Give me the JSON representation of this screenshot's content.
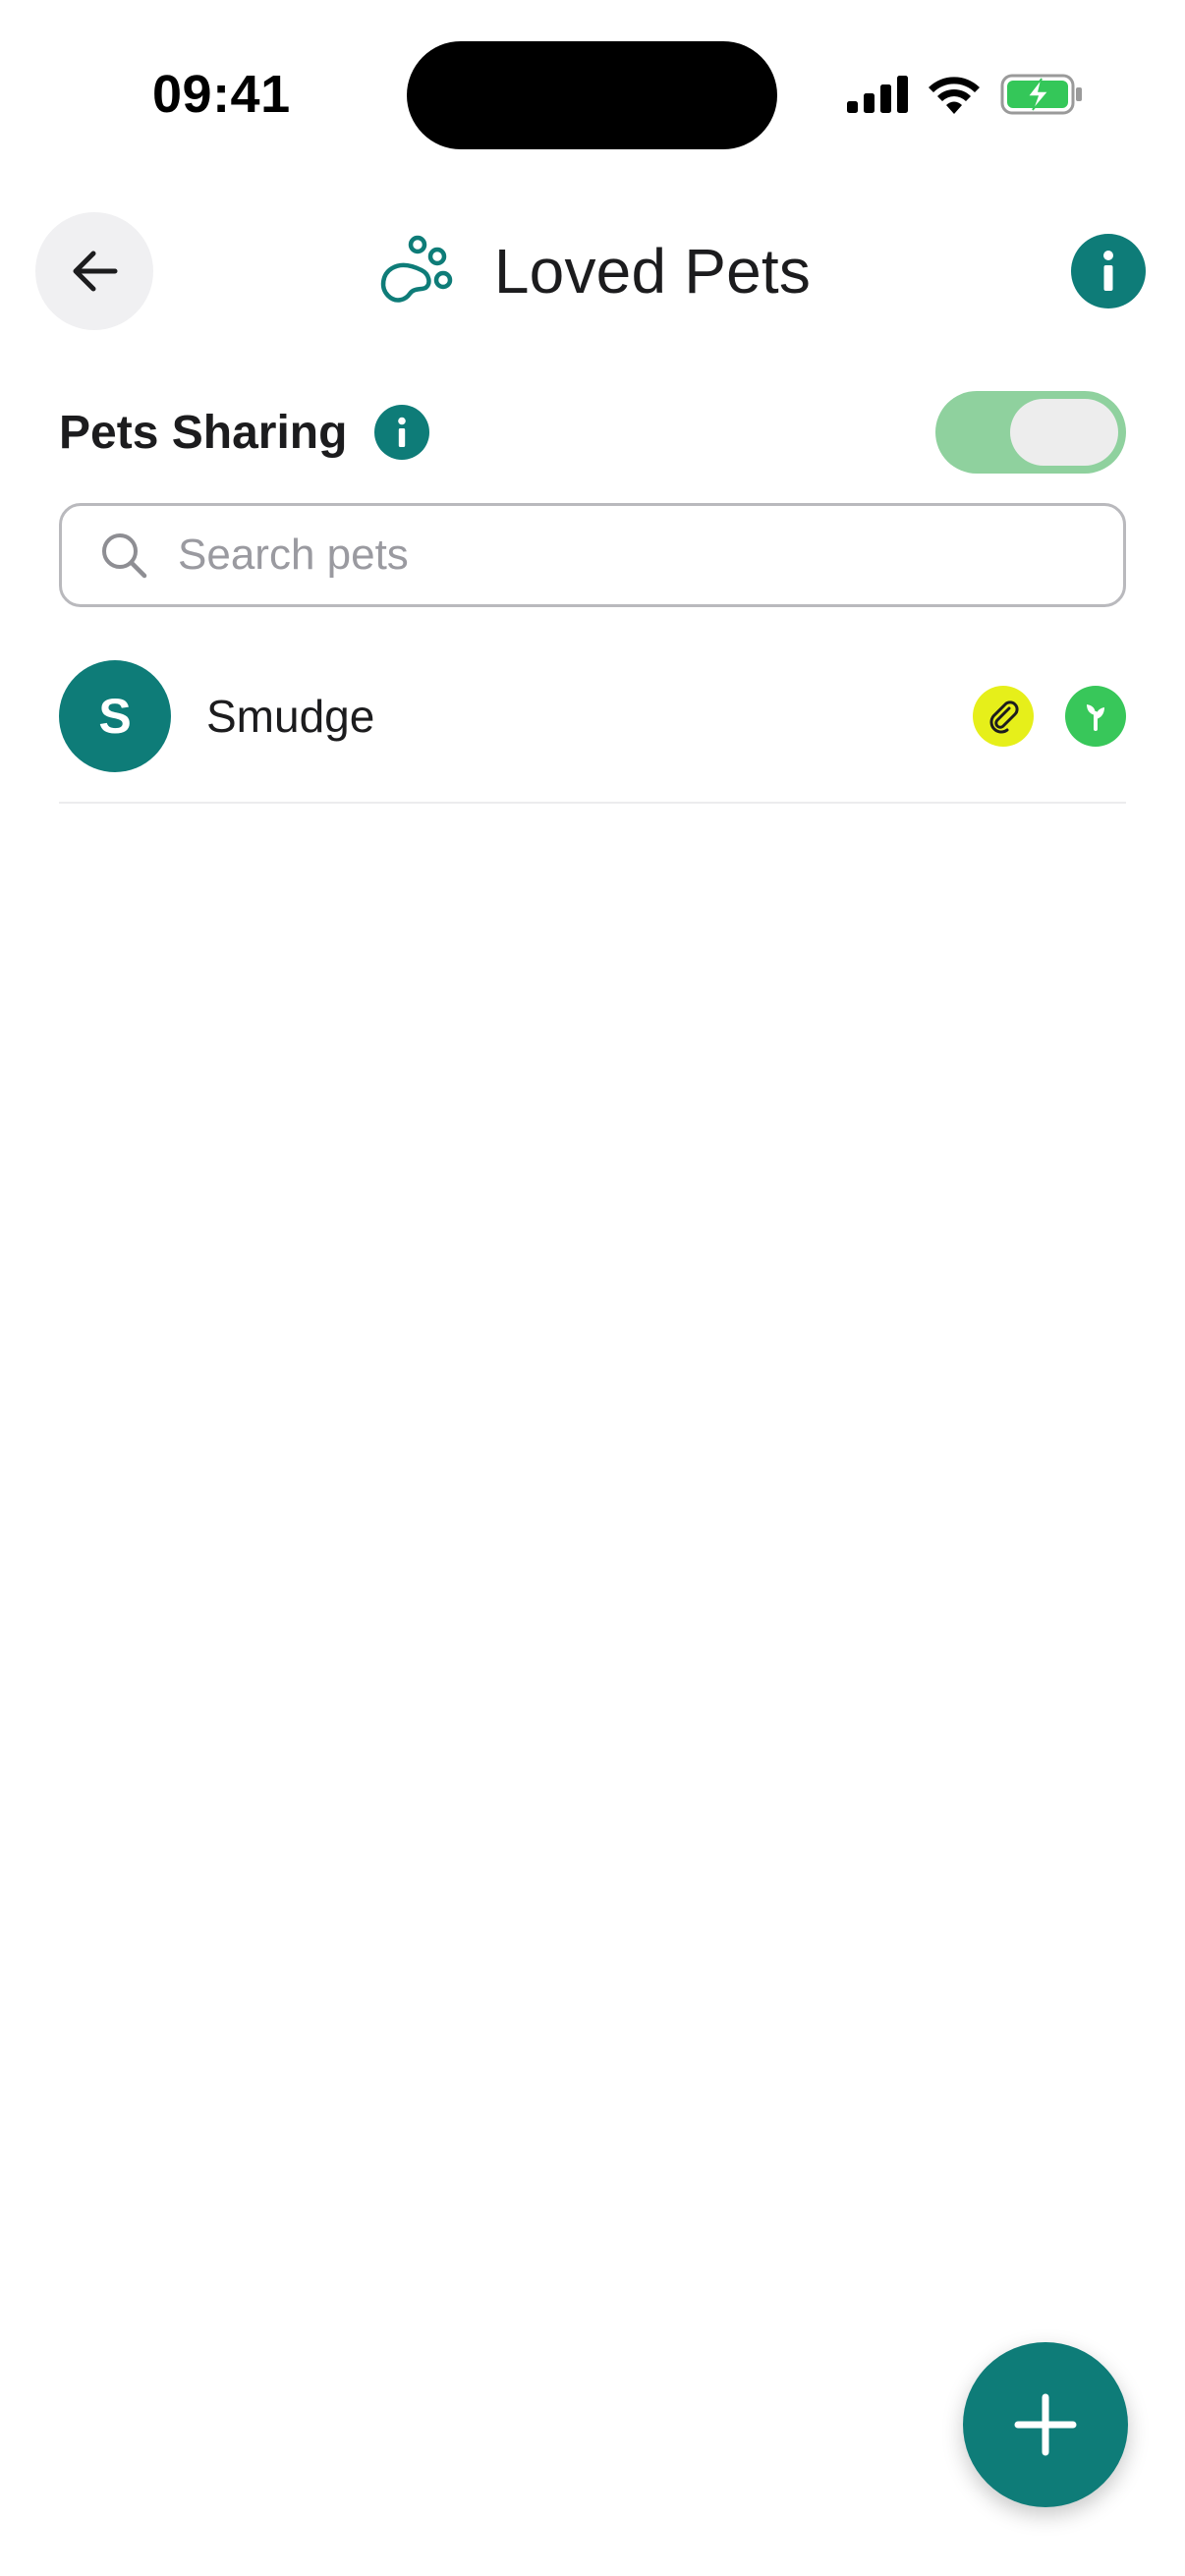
{
  "status_bar": {
    "time": "09:41",
    "icons": [
      "cellular-signal-icon",
      "wifi-icon",
      "battery-charging-icon"
    ]
  },
  "header": {
    "title": "Loved Pets",
    "back_icon": "arrow-left-icon",
    "title_icon": "paw-icon",
    "info_icon": "info-icon"
  },
  "sharing": {
    "label": "Pets Sharing",
    "info_icon": "info-icon",
    "toggle_on": true
  },
  "search": {
    "placeholder": "Search pets",
    "value": ""
  },
  "pets": [
    {
      "initial": "S",
      "name": "Smudge",
      "badges": [
        "paperclip-icon",
        "leaf-icon"
      ]
    }
  ],
  "fab": {
    "icon": "plus-icon"
  },
  "colors": {
    "primary": "#0e7c78",
    "toggle_track": "#8fd19e",
    "attachment_badge": "#e6ef1a",
    "leaf_badge": "#38c75a"
  }
}
